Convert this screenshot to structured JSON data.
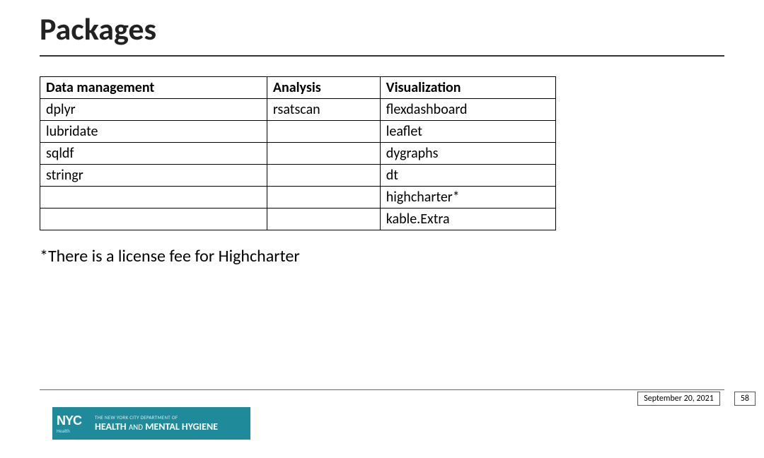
{
  "title": "Packages",
  "table": {
    "headers": [
      "Data management",
      "Analysis",
      "Visualization"
    ],
    "rows": [
      [
        "dplyr",
        "rsatscan",
        "flexdashboard"
      ],
      [
        "lubridate",
        "",
        "leaflet"
      ],
      [
        "sqldf",
        "",
        "dygraphs"
      ],
      [
        "stringr",
        "",
        "dt"
      ],
      [
        "",
        "",
        "highcharter*"
      ],
      [
        "",
        "",
        "kable.Extra"
      ]
    ]
  },
  "footnote": "*There is a license fee for Highcharter",
  "logo": {
    "nyc": "NYC",
    "health_small": "Health",
    "line1": "THE NEW YORK CITY DEPARTMENT OF",
    "line2_a": "HEALTH",
    "line2_and": "AND",
    "line2_b": "MENTAL HYGIENE"
  },
  "footer_date": "September 20, 2021",
  "page_number": "58"
}
